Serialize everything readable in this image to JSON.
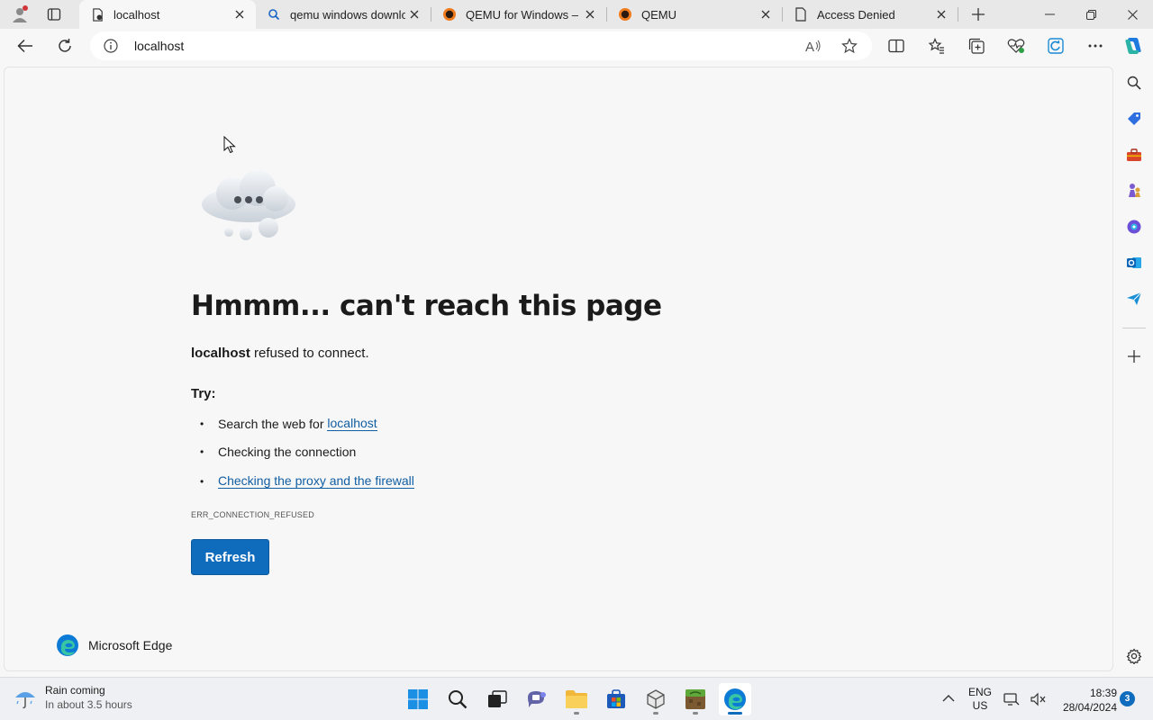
{
  "browser": {
    "tabs": [
      {
        "title": "localhost",
        "active": true
      },
      {
        "title": "qemu windows downloa",
        "active": false
      },
      {
        "title": "QEMU for Windows – In",
        "active": false
      },
      {
        "title": "QEMU",
        "active": false
      },
      {
        "title": "Access Denied",
        "active": false
      }
    ],
    "address": "localhost"
  },
  "error_page": {
    "title": "Hmmm... can't reach this page",
    "host": "localhost",
    "message_rest": " refused to connect.",
    "try_label": "Try:",
    "suggestion_1_prefix": "Search the web for ",
    "suggestion_1_link": "localhost",
    "suggestion_2": "Checking the connection",
    "suggestion_3_link": "Checking the proxy and the firewall",
    "error_code": "ERR_CONNECTION_REFUSED",
    "refresh_label": "Refresh",
    "brand": "Microsoft Edge"
  },
  "taskbar": {
    "weather_title": "Rain coming",
    "weather_subtitle": "In about 3.5 hours",
    "lang_line1": "ENG",
    "lang_line2": "US",
    "time": "18:39",
    "date": "28/04/2024",
    "notification_count": "3"
  },
  "colors": {
    "accent": "#0f6cbd",
    "link": "#115ea3"
  }
}
